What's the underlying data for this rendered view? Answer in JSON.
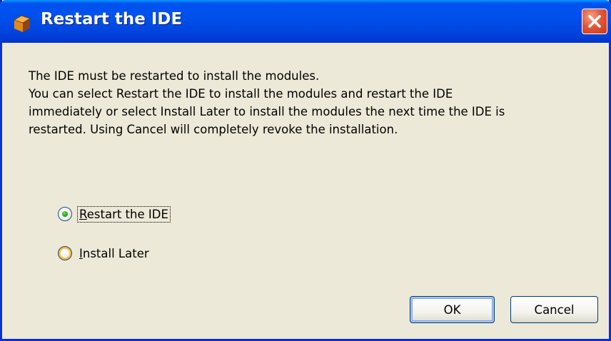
{
  "window": {
    "title": "Restart the IDE"
  },
  "message": {
    "lines": [
      "The IDE must be restarted to install the modules.",
      "You can select Restart the IDE to install the modules and restart the IDE",
      "immediately or select Install Later to install the modules the next time the IDE is",
      "restarted. Using Cancel will completely revoke the installation."
    ]
  },
  "options": [
    {
      "mnemonic": "R",
      "rest": "estart the IDE",
      "selected": true
    },
    {
      "mnemonic": "I",
      "rest": "nstall Later",
      "selected": false
    }
  ],
  "buttons": {
    "ok_label": "OK",
    "cancel_label": "Cancel"
  },
  "icons": {
    "app": "netbeans-cube-icon",
    "close": "close-x-icon"
  },
  "colors": {
    "title_bar": "#0053EE",
    "close_button": "#E2583A",
    "dialog_background": "#ECE9D8",
    "radio_selected_dot": "#21A121"
  }
}
